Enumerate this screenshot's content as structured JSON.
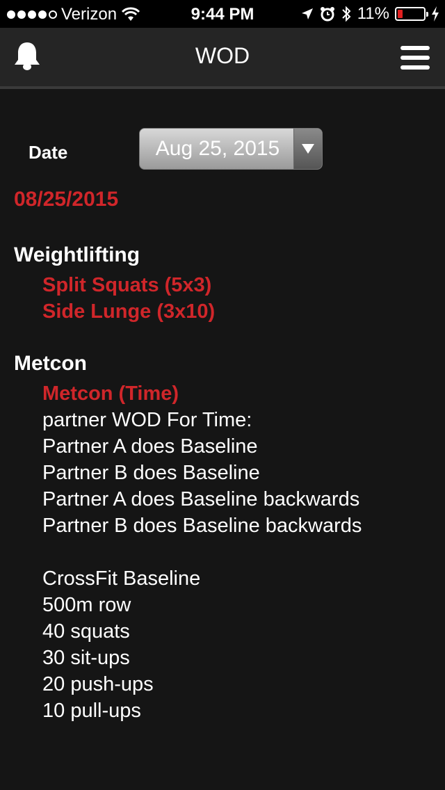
{
  "status_bar": {
    "carrier": "Verizon",
    "time": "9:44 PM",
    "battery_percent": "11%",
    "battery_level": 0.11,
    "signal_bars": 4,
    "icons": [
      "wifi-icon",
      "location-arrow-icon",
      "alarm-icon",
      "bluetooth-icon",
      "charging-bolt-icon"
    ]
  },
  "nav": {
    "title": "WOD",
    "left_icon": "bell-icon",
    "right_icon": "hamburger-menu-icon"
  },
  "date_picker": {
    "label": "Date",
    "value": "Aug 25, 2015"
  },
  "wod_date": "08/25/2015",
  "sections": {
    "weightlifting": {
      "title": "Weightlifting",
      "items": [
        "Split Squats (5x3)",
        "Side Lunge (3x10)"
      ]
    },
    "metcon": {
      "title": "Metcon",
      "subtitle": "Metcon (Time)",
      "lines": [
        "partner WOD For Time:",
        "Partner A does Baseline",
        "Partner B does Baseline",
        "Partner A does Baseline backwards",
        "Partner B does Baseline backwards",
        "",
        "CrossFit Baseline",
        "500m row",
        "40 squats",
        "30 sit-ups",
        "20 push-ups",
        "10 pull-ups"
      ]
    }
  },
  "colors": {
    "accent_red": "#d0262a",
    "background": "#151515",
    "nav_background": "#252525"
  }
}
